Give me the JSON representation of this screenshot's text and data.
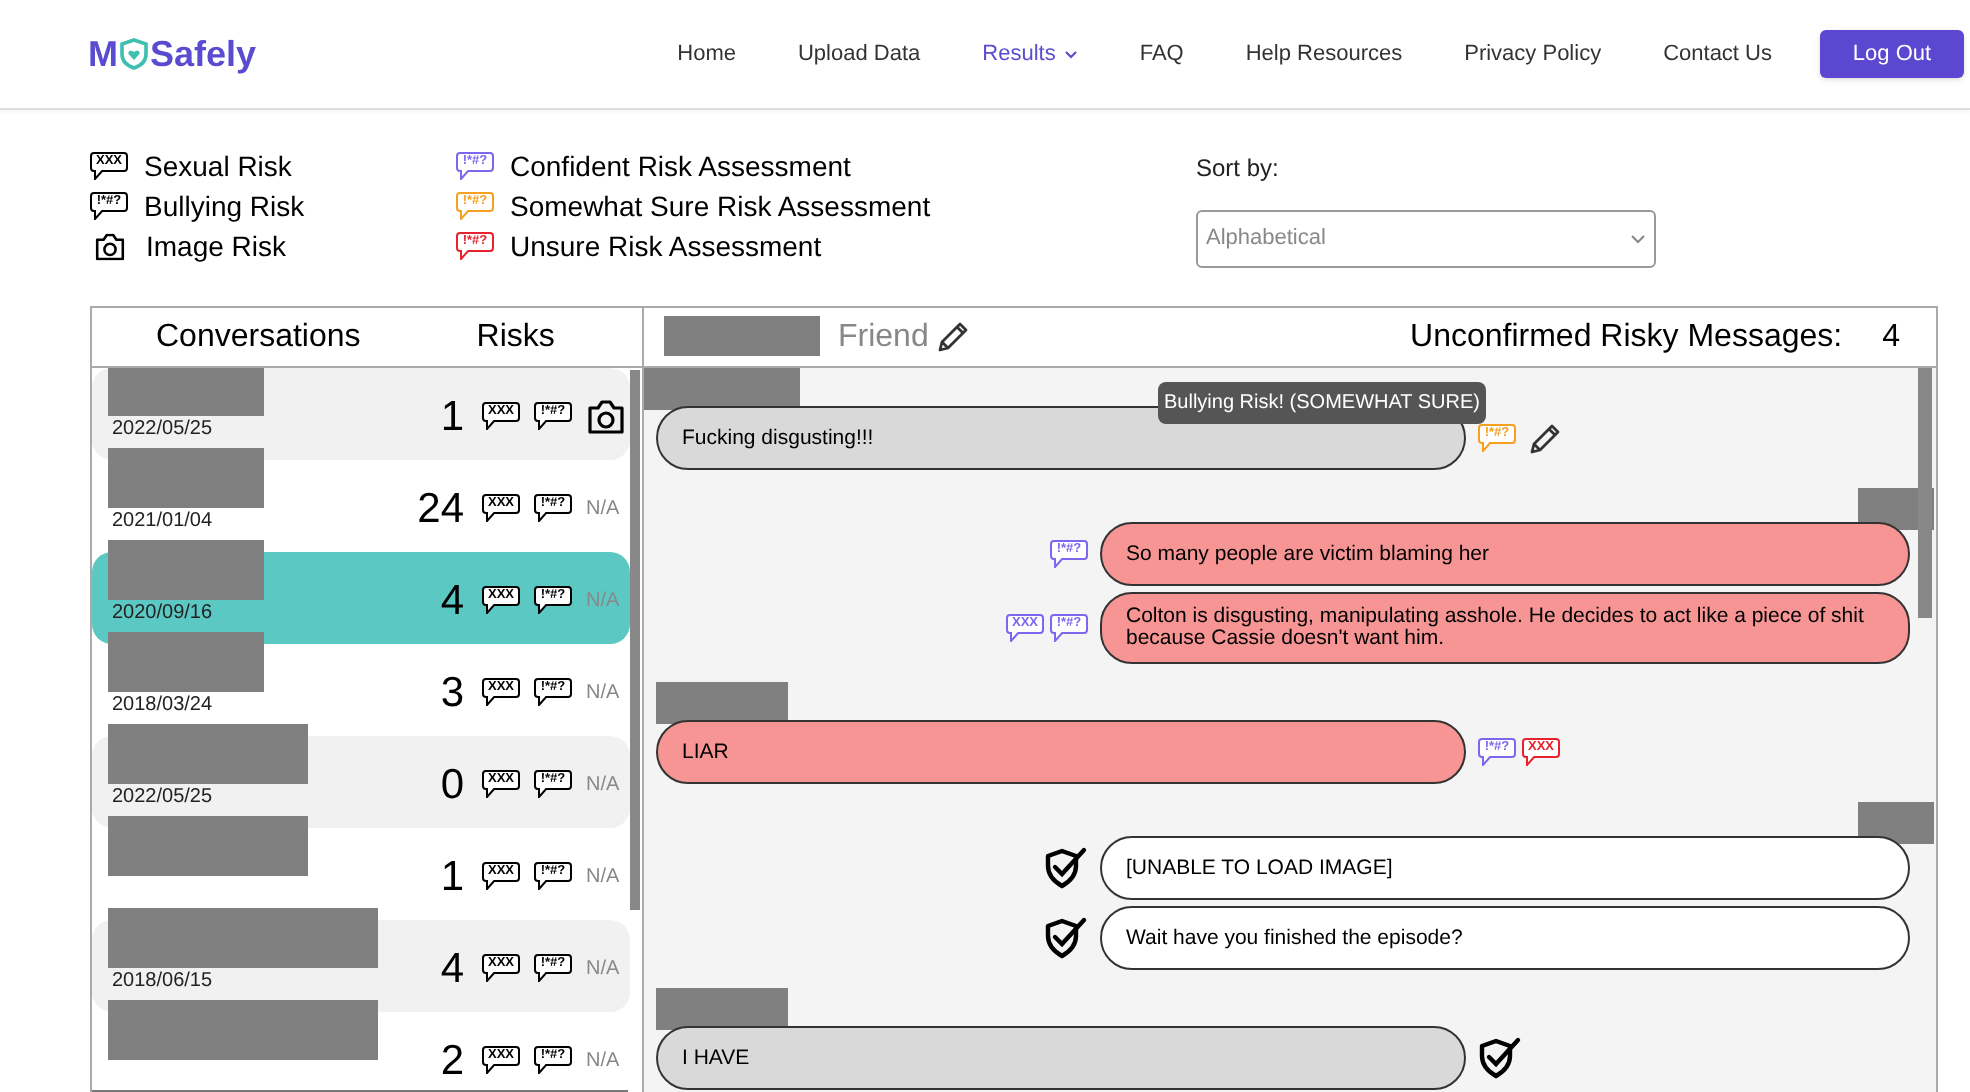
{
  "logo": {
    "before": "M",
    "after": "Safely"
  },
  "nav": [
    {
      "label": "Home",
      "selected": false,
      "dropdown": false
    },
    {
      "label": "Upload Data",
      "selected": false,
      "dropdown": false
    },
    {
      "label": "Results",
      "selected": true,
      "dropdown": true
    },
    {
      "label": "FAQ",
      "selected": false,
      "dropdown": false
    },
    {
      "label": "Help Resources",
      "selected": false,
      "dropdown": false
    },
    {
      "label": "Privacy Policy",
      "selected": false,
      "dropdown": false
    },
    {
      "label": "Contact Us",
      "selected": false,
      "dropdown": false
    }
  ],
  "logout": "Log Out",
  "legend_types": [
    {
      "kind": "sexual",
      "mark": "XXX",
      "label": "Sexual Risk"
    },
    {
      "kind": "bullying",
      "mark": "!*#?",
      "label": "Bullying Risk"
    },
    {
      "kind": "image",
      "label": "Image Risk"
    }
  ],
  "legend_certainty": [
    {
      "color": "#7b68ee",
      "mark": "!*#?",
      "label": "Confident Risk Assessment"
    },
    {
      "color": "#f5a020",
      "mark": "!*#?",
      "label": "Somewhat Sure Risk Assessment"
    },
    {
      "color": "#e8222c",
      "mark": "!*#?",
      "label": "Unsure Risk Assessment"
    }
  ],
  "sort": {
    "label": "Sort by:",
    "value": "Alphabetical"
  },
  "conversations": {
    "columns": [
      "Conversations",
      "Risks"
    ],
    "rows": [
      {
        "date": "2022/05/25",
        "count": "1",
        "selected": false,
        "sexual_mark": "XXX",
        "bullying_mark": "!*#?",
        "image_risk": true
      },
      {
        "date": "2021/01/04",
        "count": "24",
        "selected": false,
        "sexual_mark": "XXX",
        "bullying_mark": "!*#?",
        "image_risk": false,
        "image_text": "N/A"
      },
      {
        "date": "2020/09/16",
        "count": "4",
        "selected": true,
        "sexual_mark": "XXX",
        "bullying_mark": "!*#?",
        "image_risk": false,
        "image_text": "N/A"
      },
      {
        "date": "2018/03/24",
        "count": "3",
        "selected": false,
        "sexual_mark": "XXX",
        "bullying_mark": "!*#?",
        "image_risk": false,
        "image_text": "N/A"
      },
      {
        "date": "2022/05/25",
        "count": "0",
        "selected": false,
        "sexual_mark": "XXX",
        "bullying_mark": "!*#?",
        "image_risk": false,
        "image_text": "N/A"
      },
      {
        "count": "1",
        "selected": false,
        "sexual_mark": "XXX",
        "bullying_mark": "!*#?",
        "image_risk": false,
        "image_text": "N/A"
      },
      {
        "date": "2018/06/15",
        "count": "4",
        "selected": false,
        "sexual_mark": "XXX",
        "bullying_mark": "!*#?",
        "image_risk": false,
        "image_text": "N/A"
      },
      {
        "count": "2",
        "selected": false,
        "sexual_mark": "XXX",
        "bullying_mark": "!*#?",
        "image_risk": false,
        "image_text": "N/A"
      }
    ]
  },
  "chat": {
    "contact": "Friend",
    "unconfirmed_label": "Unconfirmed Risky Messages:",
    "unconfirmed_count": "4",
    "messages": [
      {
        "outgoing": false,
        "kind": "pending",
        "verified": false,
        "text": "Fucking disgusting!!!",
        "tooltip": "Bullying Risk! (SOMEWHAT SURE)",
        "editable": true,
        "risks": [
          {
            "mark": "!*#?",
            "color": "#f5a020"
          }
        ]
      },
      {
        "outgoing": true,
        "kind": "risky",
        "verified": false,
        "text": "So many people are victim blaming her",
        "risks": [
          {
            "mark": "!*#?",
            "color": "#7b68ee"
          }
        ]
      },
      {
        "outgoing": true,
        "kind": "risky",
        "verified": false,
        "text": "Colton is disgusting, manipulating asshole. He decides to act like a piece of shit because Cassie doesn't want him.",
        "risks": [
          {
            "mark": "XXX",
            "color": "#7b68ee"
          },
          {
            "mark": "!*#?",
            "color": "#7b68ee"
          }
        ]
      },
      {
        "outgoing": false,
        "kind": "risky",
        "verified": false,
        "text": "LIAR",
        "risks": [
          {
            "mark": "!*#?",
            "color": "#7b68ee"
          },
          {
            "mark": "XXX",
            "color": "#e8222c"
          }
        ]
      },
      {
        "outgoing": true,
        "kind": "safe",
        "verified": true,
        "text": "[UNABLE TO LOAD IMAGE]"
      },
      {
        "outgoing": true,
        "kind": "safe",
        "verified": true,
        "text": "Wait have you finished the episode?"
      },
      {
        "outgoing": false,
        "kind": "pending",
        "verified": true,
        "text": "I HAVE"
      }
    ]
  }
}
